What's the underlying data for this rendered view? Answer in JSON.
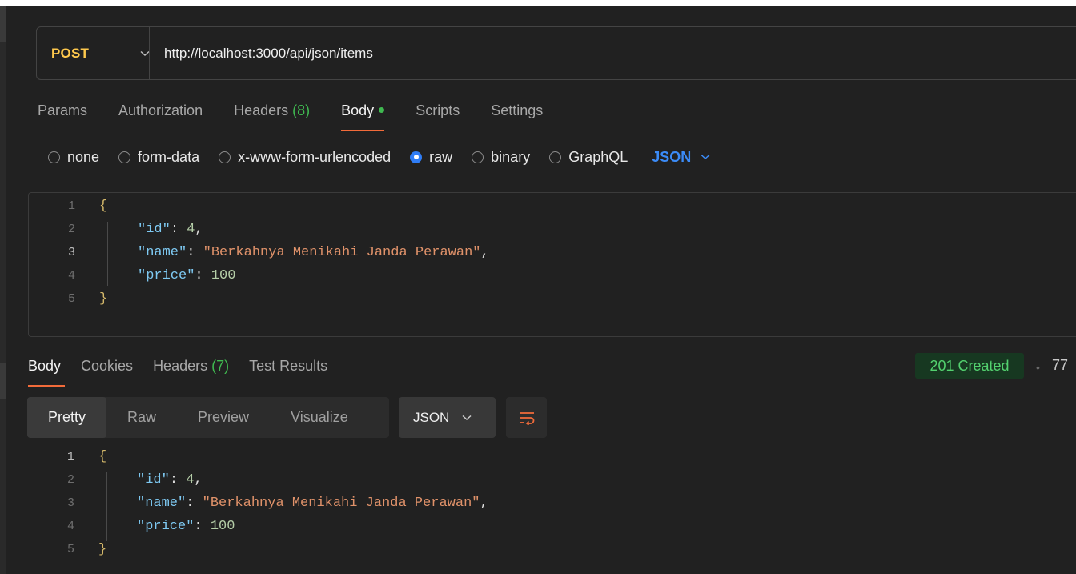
{
  "request": {
    "method": "POST",
    "url": "http://localhost:3000/api/json/items",
    "tabs": [
      {
        "label": "Params",
        "count": ""
      },
      {
        "label": "Authorization",
        "count": ""
      },
      {
        "label": "Headers",
        "count": "(8)"
      },
      {
        "label": "Body",
        "count": ""
      },
      {
        "label": "Scripts",
        "count": ""
      },
      {
        "label": "Settings",
        "count": ""
      }
    ],
    "active_tab": "Body",
    "body_types": [
      "none",
      "form-data",
      "x-www-form-urlencoded",
      "raw",
      "binary",
      "GraphQL"
    ],
    "selected_body_type": "raw",
    "raw_format": "JSON"
  },
  "request_body": {
    "line_numbers": [
      "1",
      "2",
      "3",
      "4",
      "5"
    ],
    "open_brace": "{",
    "close_brace": "}",
    "fields": [
      {
        "key": "\"id\"",
        "value": "4",
        "value_type": "number",
        "trail": ","
      },
      {
        "key": "\"name\"",
        "value": "\"Berkahnya Menikahi Janda Perawan\"",
        "value_type": "string",
        "trail": ","
      },
      {
        "key": "\"price\"",
        "value": "100",
        "value_type": "number",
        "trail": ""
      }
    ]
  },
  "response": {
    "tabs": [
      {
        "label": "Body",
        "count": ""
      },
      {
        "label": "Cookies",
        "count": ""
      },
      {
        "label": "Headers",
        "count": "(7)"
      },
      {
        "label": "Test Results",
        "count": ""
      }
    ],
    "active_tab": "Body",
    "status": "201 Created",
    "time": "77",
    "views": [
      "Pretty",
      "Raw",
      "Preview",
      "Visualize"
    ],
    "active_view": "Pretty",
    "format": "JSON",
    "wrap_icon": "wrap-lines-icon"
  },
  "response_body": {
    "line_numbers": [
      "1",
      "2",
      "3",
      "4",
      "5"
    ],
    "open_brace": "{",
    "close_brace": "}",
    "fields": [
      {
        "key": "\"id\"",
        "value": "4",
        "value_type": "number",
        "trail": ","
      },
      {
        "key": "\"name\"",
        "value": "\"Berkahnya Menikahi Janda Perawan\"",
        "value_type": "string",
        "trail": ","
      },
      {
        "key": "\"price\"",
        "value": "100",
        "value_type": "number",
        "trail": ""
      }
    ]
  },
  "colors": {
    "background": "#212121",
    "method": "#ffc94d",
    "accent": "#f26b3a",
    "link_blue": "#3b8bf7",
    "success": "#53d16f"
  }
}
